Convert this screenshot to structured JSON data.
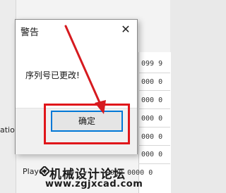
{
  "dialog": {
    "title": "警告",
    "close_glyph": "✕",
    "message": "序列号已更改!",
    "ok_label": "确定"
  },
  "background": {
    "row_fragments": [
      "099 9",
      "000 0",
      "000 0",
      "000 0",
      "000 0",
      "000 0"
    ],
    "label_ation": "ation",
    "label_player": "Player",
    "cell_player_row": "9000 0000 0"
  },
  "watermark": {
    "line1": "机械设计论坛",
    "line2": "www.zgjxcad.com"
  },
  "colors": {
    "highlight": "#e0161b",
    "arrow": "#d61a1f",
    "button_focus": "#0078d7"
  }
}
